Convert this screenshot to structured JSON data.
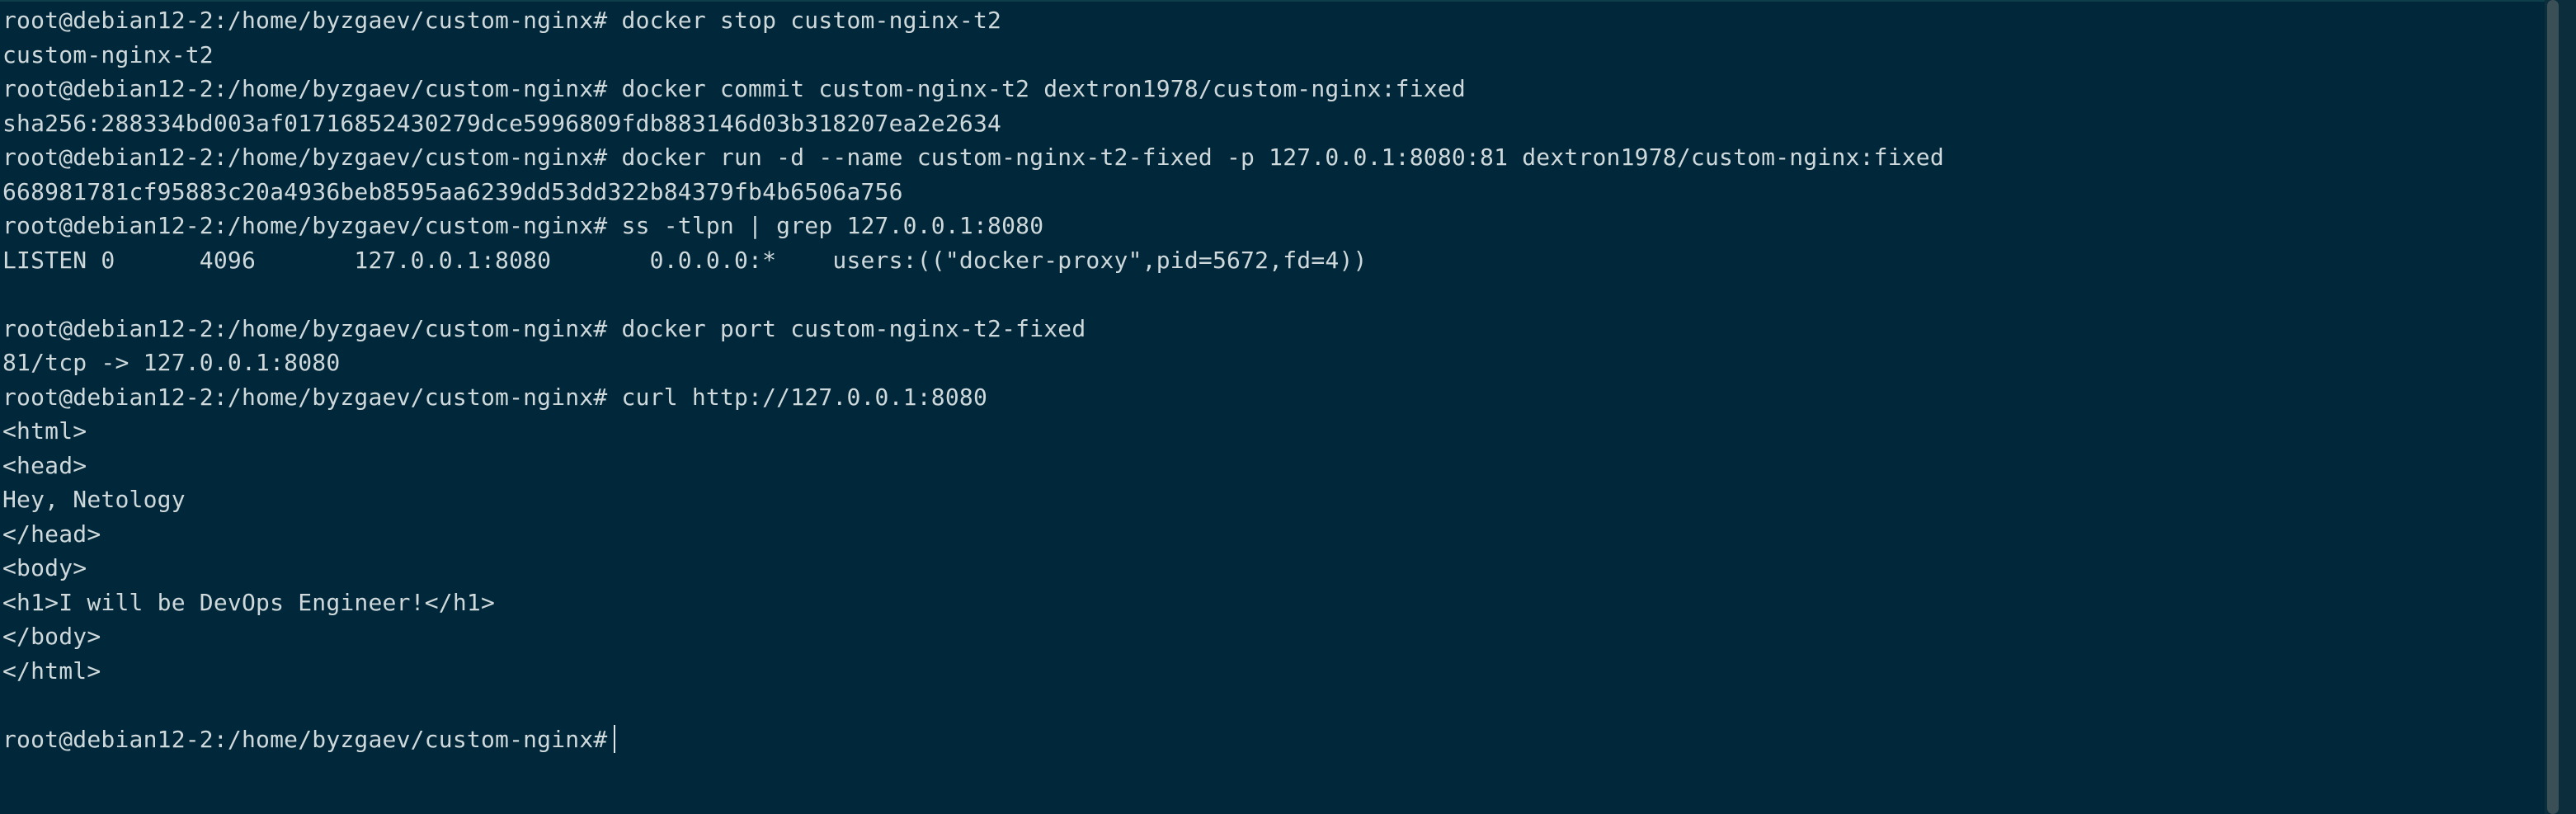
{
  "terminal": {
    "lines": [
      {
        "text": "root@debian12-2:/home/byzgaev/custom-nginx# docker stop custom-nginx-t2"
      },
      {
        "text": "custom-nginx-t2"
      },
      {
        "text": "root@debian12-2:/home/byzgaev/custom-nginx# docker commit custom-nginx-t2 dextron1978/custom-nginx:fixed"
      },
      {
        "text": "sha256:288334bd003af01716852430279dce5996809fdb883146d03b318207ea2e2634"
      },
      {
        "text": "root@debian12-2:/home/byzgaev/custom-nginx# docker run -d --name custom-nginx-t2-fixed -p 127.0.0.1:8080:81 dextron1978/custom-nginx:fixed"
      },
      {
        "text": "668981781cf95883c20a4936beb8595aa6239dd53dd322b84379fb4b6506a756"
      },
      {
        "text": "root@debian12-2:/home/byzgaev/custom-nginx# ss -tlpn | grep 127.0.0.1:8080"
      },
      {
        "text": "LISTEN 0      4096       127.0.0.1:8080       0.0.0.0:*    users:((\"docker-proxy\",pid=5672,fd=4))"
      },
      {
        "text": ""
      },
      {
        "text": "root@debian12-2:/home/byzgaev/custom-nginx# docker port custom-nginx-t2-fixed"
      },
      {
        "text": "81/tcp -> 127.0.0.1:8080"
      },
      {
        "text": "root@debian12-2:/home/byzgaev/custom-nginx# curl http://127.0.0.1:8080"
      },
      {
        "text": "<html>"
      },
      {
        "text": "<head>"
      },
      {
        "text": "Hey, Netology"
      },
      {
        "text": "</head>"
      },
      {
        "text": "<body>"
      },
      {
        "text": "<h1>I will be DevOps Engineer!</h1>"
      },
      {
        "text": "</body>"
      },
      {
        "text": "</html>"
      },
      {
        "text": ""
      }
    ],
    "prompt": "root@debian12-2:/home/byzgaev/custom-nginx#"
  },
  "colors": {
    "background": "#00283a",
    "foreground": "#cfd9dc",
    "scrollbar_thumb": "#3b4f57"
  }
}
